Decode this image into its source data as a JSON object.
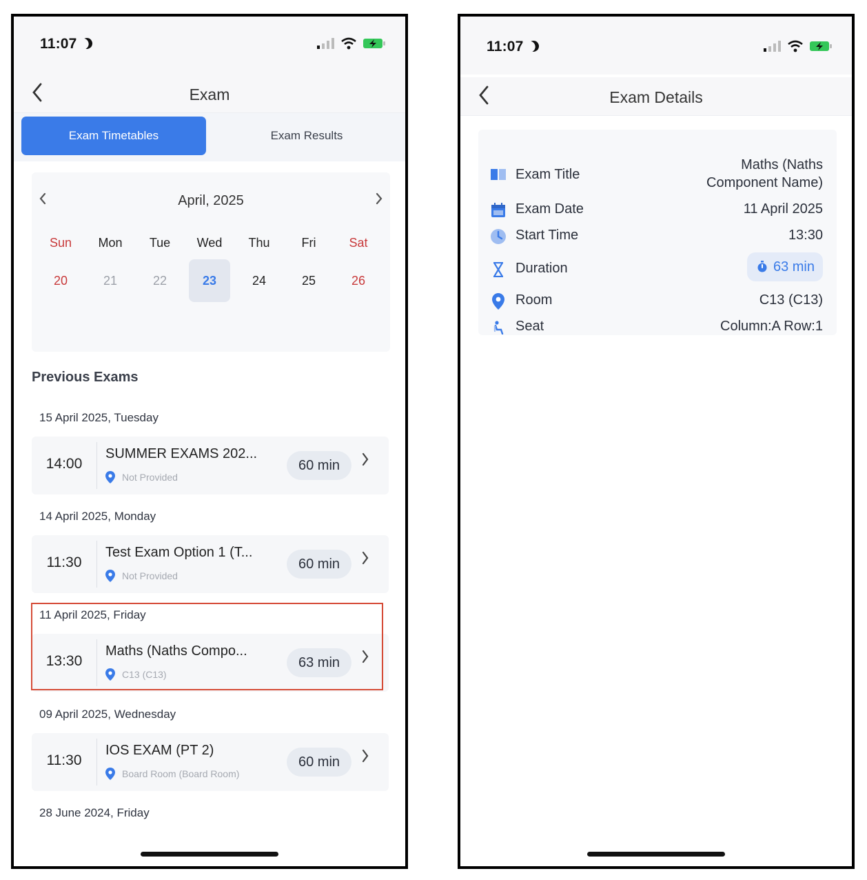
{
  "status": {
    "time": "11:07"
  },
  "left": {
    "nav_title": "Exam",
    "tabs": [
      {
        "label": "Exam Timetables",
        "active": true
      },
      {
        "label": "Exam Results",
        "active": false
      }
    ],
    "calendar": {
      "month": "April, 2025",
      "weekdays": [
        "Sun",
        "Mon",
        "Tue",
        "Wed",
        "Thu",
        "Fri",
        "Sat"
      ],
      "days": [
        "20",
        "21",
        "22",
        "23",
        "24",
        "25",
        "26"
      ],
      "selected": "23"
    },
    "section_title": "Previous Exams",
    "groups": [
      {
        "date": "15 April 2025, Tuesday",
        "time": "14:00",
        "title": "SUMMER EXAMS 202...",
        "location": "Not Provided",
        "duration": "60 min"
      },
      {
        "date": "14 April 2025, Monday",
        "time": "11:30",
        "title": "Test Exam Option 1 (T...",
        "location": "Not Provided",
        "duration": "60 min"
      },
      {
        "date": "11 April 2025, Friday",
        "time": "13:30",
        "title": "Maths (Naths Compo...",
        "location": "C13 (C13)",
        "duration": "63 min"
      },
      {
        "date": "09 April 2025, Wednesday",
        "time": "11:30",
        "title": "IOS EXAM (PT 2)",
        "location": "Board Room (Board Room)",
        "duration": "60 min"
      },
      {
        "date": "28 June 2024, Friday"
      }
    ]
  },
  "right": {
    "nav_title": "Exam Details",
    "rows": [
      {
        "label": "Exam Title",
        "value_line1": "Maths (Naths",
        "value_line2": "Component Name)"
      },
      {
        "label": "Exam Date",
        "value": "11 April 2025"
      },
      {
        "label": "Start Time",
        "value": "13:30"
      },
      {
        "label": "Duration",
        "value": "63 min"
      },
      {
        "label": "Room",
        "value": "C13 (C13)"
      },
      {
        "label": "Seat",
        "value": "Column:A Row:1"
      }
    ]
  },
  "colors": {
    "accent": "#3a7be8",
    "weekend": "#c8393a",
    "highlight_border": "#d54b37",
    "battery": "#34c759"
  }
}
